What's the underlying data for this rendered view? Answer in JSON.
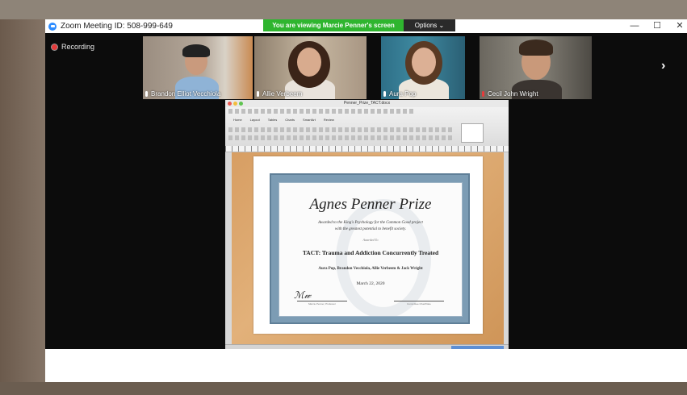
{
  "window": {
    "title": "Zoom Meeting ID: 508-999-649",
    "minimize_glyph": "—",
    "maximize_glyph": "☐",
    "close_glyph": "✕"
  },
  "banner": {
    "viewing_text": "You are viewing Marcie Penner's screen",
    "options_label": "Options",
    "options_chevron": "⌄"
  },
  "recording": {
    "label": "Recording"
  },
  "participants": [
    {
      "name": "Brandon Elliot Vecchiola",
      "muted": false
    },
    {
      "name": "Allie Verbeem",
      "muted": false
    },
    {
      "name": "Aura Pop",
      "muted": false
    },
    {
      "name": "Cecil John Wright",
      "muted": true
    }
  ],
  "nav": {
    "next_glyph": "›"
  },
  "shared_doc": {
    "file_name": "Penner_Prize_TACT.docx",
    "ribbon_tabs": [
      "Home",
      "Layout",
      "Tables",
      "Charts",
      "SmartArt",
      "Review"
    ],
    "certificate": {
      "title": "Agnes Penner Prize",
      "subtitle_line1": "Awarded to the King's Psychology for the Common Good project",
      "subtitle_line2": "with the greatest potential to benefit society.",
      "awarded_to": "Awarded To",
      "project": "TACT: Trauma and Addiction Concurrently Treated",
      "names": "Aura Pop, Brandon Vecchiola, Allie Verbeem & Jack Wright",
      "date": "March 22, 2020",
      "sig_left_label": "Marcie Penner, Professor",
      "sig_right_label": "Committee Chair/Date"
    }
  },
  "colors": {
    "banner_green": "#2fb52f",
    "zoom_blue": "#2d8cff",
    "record_red": "#e53b3b",
    "frame_blue": "#7c9cb4"
  }
}
